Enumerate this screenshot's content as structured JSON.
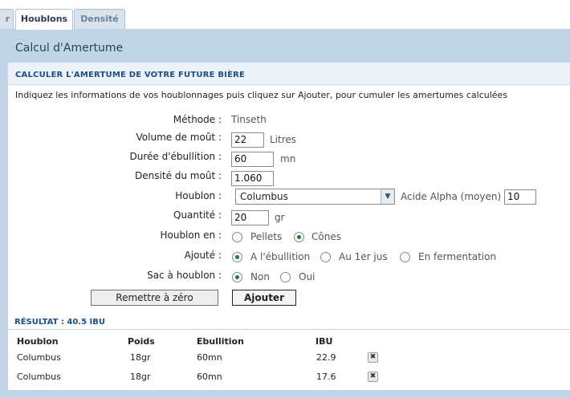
{
  "tabs": [
    {
      "label": "r"
    },
    {
      "label": "Houblons"
    },
    {
      "label": "Densité"
    }
  ],
  "panel_title": "Calcul d'Amertume",
  "section_title": "CALCULER L'AMERTUME DE VOTRE FUTURE BIÈRE",
  "intro": "Indiquez les informations de vos houblonnages puis cliquez sur Ajouter, pour cumuler les amertumes calculées",
  "form": {
    "methode_label": "Méthode :",
    "methode_value": "Tinseth",
    "volume_label": "Volume de moût :",
    "volume_value": "22",
    "volume_unit": "Litres",
    "duree_label": "Durée d'ébullition :",
    "duree_value": "60",
    "duree_unit": "mn",
    "densite_label": "Densité du moût :",
    "densite_value": "1.060",
    "houblon_label": "Houblon :",
    "houblon_value": "Columbus",
    "acide_label": "Acide Alpha (moyen)",
    "acide_value": "10",
    "quantite_label": "Quantité :",
    "quantite_value": "20",
    "quantite_unit": "gr",
    "forme_label": "Houblon en :",
    "forme_options": [
      "Pellets",
      "Cônes"
    ],
    "forme_selected": "Cônes",
    "ajoute_label": "Ajouté :",
    "ajoute_options": [
      "A l'ébullition",
      "Au 1er jus",
      "En fermentation"
    ],
    "ajoute_selected": "A l'ébullition",
    "sac_label": "Sac à houblon :",
    "sac_options": [
      "Non",
      "Oui"
    ],
    "sac_selected": "Non",
    "reset_label": "Remettre à zéro",
    "add_label": "Ajouter"
  },
  "result": {
    "title": "RÉSULTAT : 40.5 IBU",
    "columns": [
      "Houblon",
      "Poids",
      "Ebullition",
      "IBU"
    ],
    "rows": [
      {
        "houblon": "Columbus",
        "poids": "18gr",
        "ebullition": "60mn",
        "ibu": "22.9"
      },
      {
        "houblon": "Columbus",
        "poids": "18gr",
        "ebullition": "60mn",
        "ibu": "17.6"
      }
    ]
  },
  "colors": {
    "panel_bg": "#c2d5e7",
    "section_title": "#1f4f82",
    "radio_selected": "#1c7d2c"
  },
  "icons": {
    "select_arrow": "chevron-down-icon",
    "delete": "delete-x-icon"
  }
}
